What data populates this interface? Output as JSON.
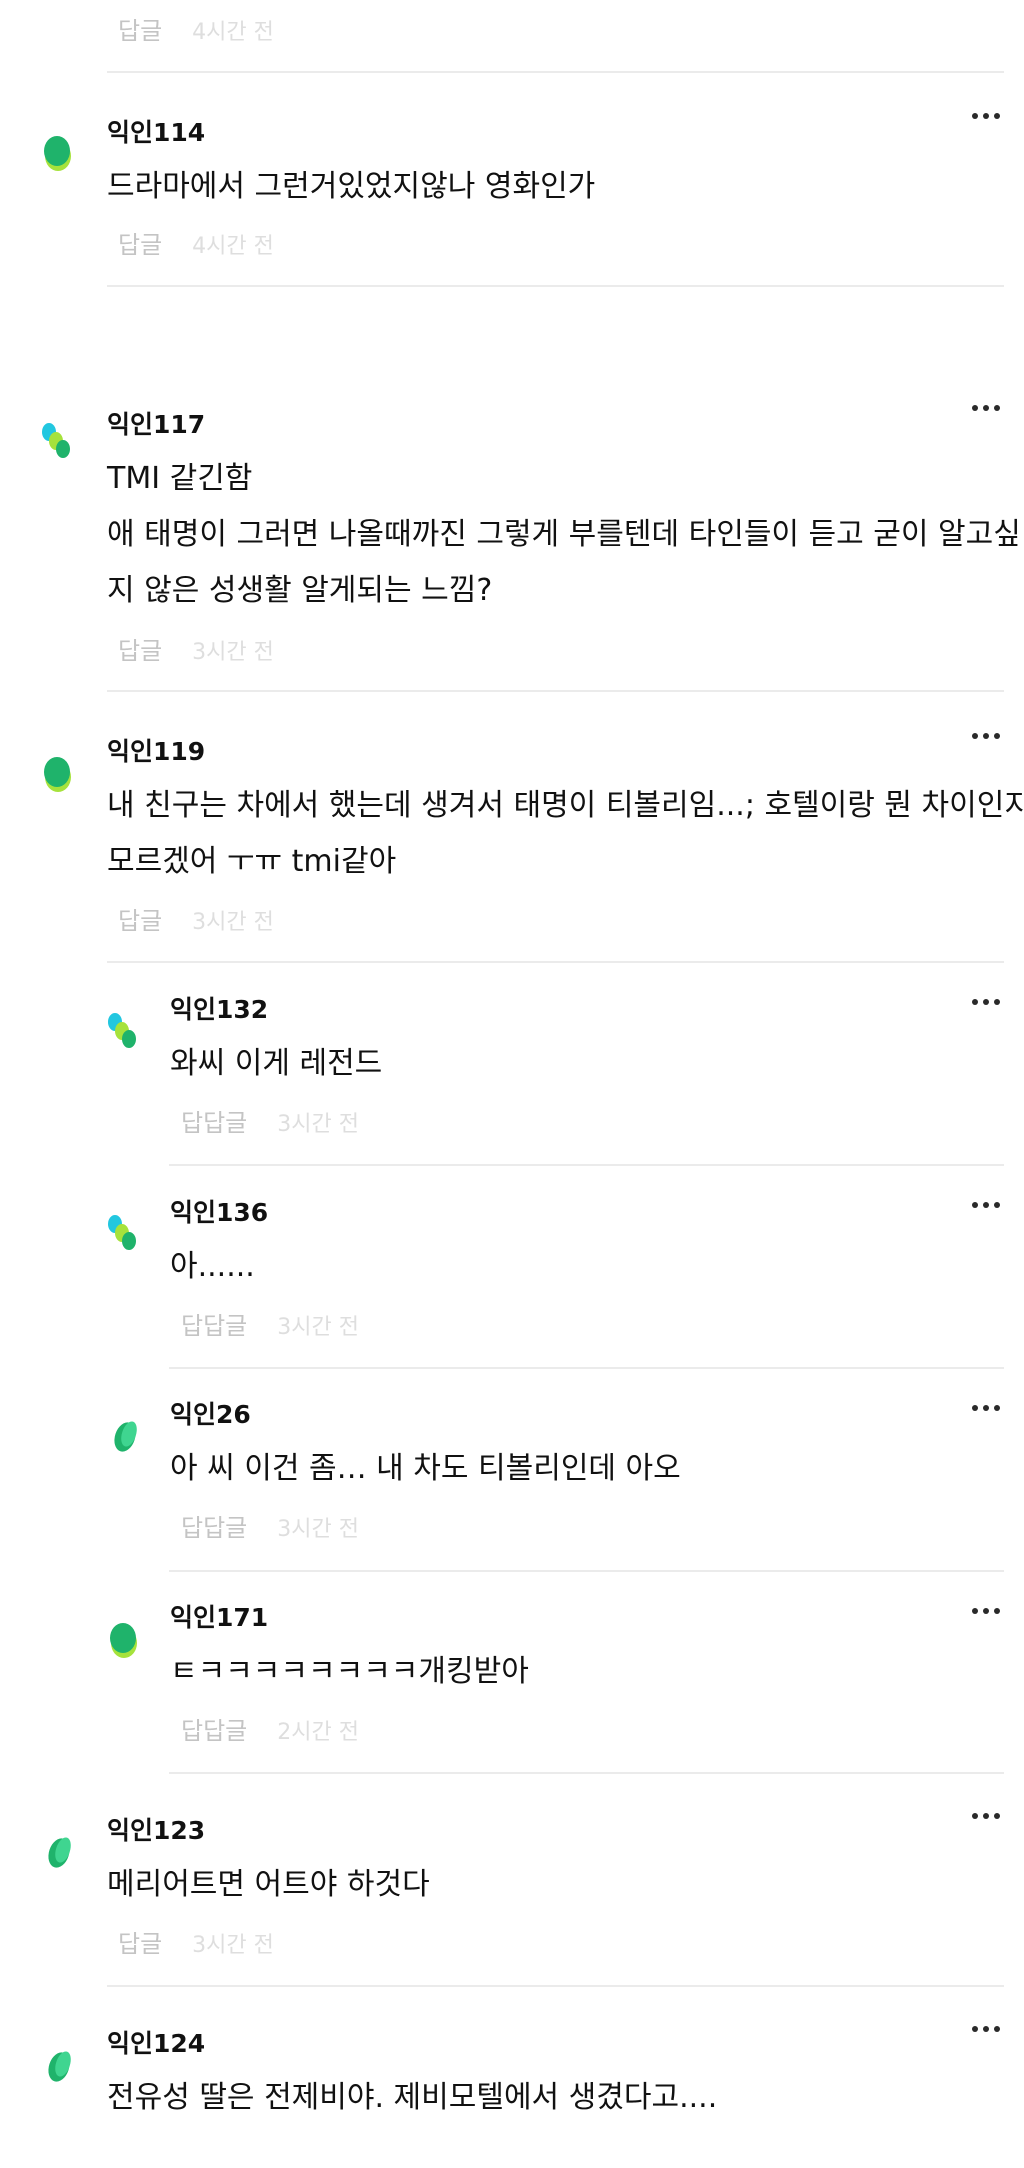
{
  "colors": {
    "accent_green": "#1fb36b",
    "accent_lime": "#a6e23c",
    "accent_cyan": "#22c7e0",
    "divider": "#ebebeb"
  },
  "top_remnant": {
    "reply_label": "답글",
    "time": "4시간 전"
  },
  "comments": [
    {
      "author": "익인114",
      "lines": [
        "드라마에서 그런거있었지않나 영화인가"
      ],
      "reply_label": "답글",
      "time": "4시간 전",
      "avatar_icon": "green-blob-avatar-icon"
    },
    {
      "author": "익인117",
      "lines": [
        "TMI 같긴함",
        "애 태명이 그러면 나올때까진 그렇게 부를텐데 타인들이 듣고 굳이 알고싶",
        "지 않은 성생활 알게되는 느낌?"
      ],
      "reply_label": "답글",
      "time": "3시간 전",
      "avatar_icon": "multicolor-blob-avatar-icon"
    },
    {
      "author": "익인119",
      "lines": [
        "내 친구는 차에서 했는데 생겨서 태명이 티볼리임...; 호텔이랑 뭔 차이인지",
        "모르겠어 ㅜㅠ tmi같아"
      ],
      "reply_label": "답글",
      "time": "3시간 전",
      "avatar_icon": "green-blob-avatar-icon"
    },
    {
      "author": "익인132",
      "lines": [
        "와씨 이게 레전드"
      ],
      "reply_label": "답답글",
      "time": "3시간 전",
      "avatar_icon": "multicolor-blob-avatar-icon"
    },
    {
      "author": "익인136",
      "lines": [
        "아......"
      ],
      "reply_label": "답답글",
      "time": "3시간 전",
      "avatar_icon": "multicolor-blob-avatar-icon"
    },
    {
      "author": "익인26",
      "lines": [
        "아 씨 이건 좀… 내 차도 티볼리인데 아오"
      ],
      "reply_label": "답답글",
      "time": "3시간 전",
      "avatar_icon": "green-blob-avatar-icon"
    },
    {
      "author": "익인171",
      "lines": [
        "ㅌㅋㅋㅋㅋㅋㅋㅋㅋ개킹받아"
      ],
      "reply_label": "답답글",
      "time": "2시간 전",
      "avatar_icon": "green-blob-avatar-icon"
    },
    {
      "author": "익인123",
      "lines": [
        "메리어트면 어트야 하것다"
      ],
      "reply_label": "답글",
      "time": "3시간 전",
      "avatar_icon": "green-blob-avatar-icon"
    },
    {
      "author": "익인124",
      "lines": [
        "전유성 딸은 전제비야. 제비모텔에서 생겼다고...."
      ],
      "avatar_icon": "green-blob-avatar-icon"
    }
  ]
}
